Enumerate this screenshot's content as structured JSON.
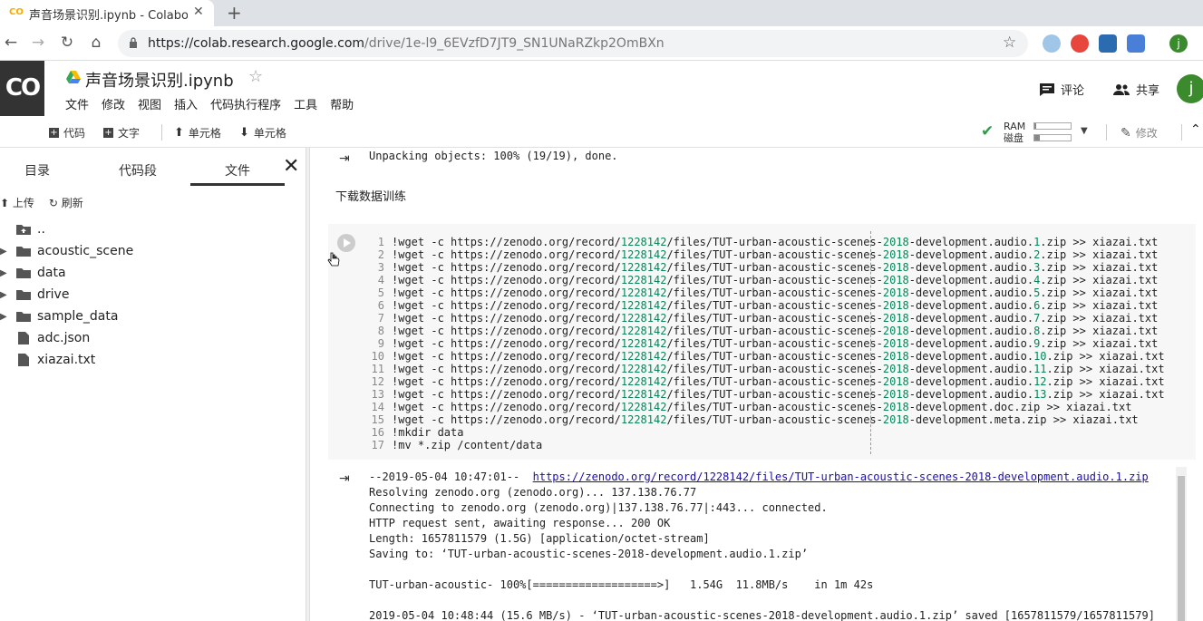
{
  "browser": {
    "tab_title": "声音场景识别.ipynb - Colabor",
    "tab_favicon": "CO",
    "url_host": "https://colab.research.google.com",
    "url_path": "/drive/1e-l9_6EVzfD7JT9_SN1UNaRZkp2OmBXn",
    "profile_initial": "j"
  },
  "header": {
    "logo": "CO",
    "notebook_title": "声音场景识别.ipynb",
    "menu": [
      "文件",
      "修改",
      "视图",
      "插入",
      "代码执行程序",
      "工具",
      "帮助"
    ],
    "comment_label": "评论",
    "share_label": "共享",
    "avatar_initial": "j"
  },
  "toolbar": {
    "add_code": "代码",
    "add_text": "文字",
    "cell_up": "单元格",
    "cell_down": "单元格",
    "ram_label": "RAM",
    "disk_label": "磁盘",
    "edit_label": "修改"
  },
  "sidebar": {
    "tabs": [
      "目录",
      "代码段",
      "文件"
    ],
    "upload_label": "上传",
    "refresh_label": "刷新",
    "files": [
      {
        "name": "..",
        "type": "parent"
      },
      {
        "name": "acoustic_scene",
        "type": "folder"
      },
      {
        "name": "data",
        "type": "folder"
      },
      {
        "name": "drive",
        "type": "folder"
      },
      {
        "name": "sample_data",
        "type": "folder"
      },
      {
        "name": "adc.json",
        "type": "file"
      },
      {
        "name": "xiazai.txt",
        "type": "file"
      }
    ]
  },
  "notebook": {
    "prev_output": "Unpacking objects: 100% (19/19), done.",
    "text_cell": "下载数据训练",
    "code_lines": [
      {
        "n": "1",
        "pre": "!wget -c https://zenodo.org/record/",
        "id": "1228142",
        "mid": "/files/TUT-urban-acoustic-scenes-",
        "yr": "2018",
        "post": "-development.audio.",
        "k": "1",
        "tail": ".zip >> xiazai.txt"
      },
      {
        "n": "2",
        "pre": "!wget -c https://zenodo.org/record/",
        "id": "1228142",
        "mid": "/files/TUT-urban-acoustic-scenes-",
        "yr": "2018",
        "post": "-development.audio.",
        "k": "2",
        "tail": ".zip >> xiazai.txt"
      },
      {
        "n": "3",
        "pre": "!wget -c https://zenodo.org/record/",
        "id": "1228142",
        "mid": "/files/TUT-urban-acoustic-scenes-",
        "yr": "2018",
        "post": "-development.audio.",
        "k": "3",
        "tail": ".zip >> xiazai.txt"
      },
      {
        "n": "4",
        "pre": "!wget -c https://zenodo.org/record/",
        "id": "1228142",
        "mid": "/files/TUT-urban-acoustic-scenes-",
        "yr": "2018",
        "post": "-development.audio.",
        "k": "4",
        "tail": ".zip >> xiazai.txt"
      },
      {
        "n": "5",
        "pre": "!wget -c https://zenodo.org/record/",
        "id": "1228142",
        "mid": "/files/TUT-urban-acoustic-scenes-",
        "yr": "2018",
        "post": "-development.audio.",
        "k": "5",
        "tail": ".zip >> xiazai.txt"
      },
      {
        "n": "6",
        "pre": "!wget -c https://zenodo.org/record/",
        "id": "1228142",
        "mid": "/files/TUT-urban-acoustic-scenes-",
        "yr": "2018",
        "post": "-development.audio.",
        "k": "6",
        "tail": ".zip >> xiazai.txt"
      },
      {
        "n": "7",
        "pre": "!wget -c https://zenodo.org/record/",
        "id": "1228142",
        "mid": "/files/TUT-urban-acoustic-scenes-",
        "yr": "2018",
        "post": "-development.audio.",
        "k": "7",
        "tail": ".zip >> xiazai.txt"
      },
      {
        "n": "8",
        "pre": "!wget -c https://zenodo.org/record/",
        "id": "1228142",
        "mid": "/files/TUT-urban-acoustic-scenes-",
        "yr": "2018",
        "post": "-development.audio.",
        "k": "8",
        "tail": ".zip >> xiazai.txt"
      },
      {
        "n": "9",
        "pre": "!wget -c https://zenodo.org/record/",
        "id": "1228142",
        "mid": "/files/TUT-urban-acoustic-scenes-",
        "yr": "2018",
        "post": "-development.audio.",
        "k": "9",
        "tail": ".zip >> xiazai.txt"
      },
      {
        "n": "10",
        "pre": "!wget -c https://zenodo.org/record/",
        "id": "1228142",
        "mid": "/files/TUT-urban-acoustic-scenes-",
        "yr": "2018",
        "post": "-development.audio.",
        "k": "10",
        "tail": ".zip >> xiazai.txt"
      },
      {
        "n": "11",
        "pre": "!wget -c https://zenodo.org/record/",
        "id": "1228142",
        "mid": "/files/TUT-urban-acoustic-scenes-",
        "yr": "2018",
        "post": "-development.audio.",
        "k": "11",
        "tail": ".zip >> xiazai.txt"
      },
      {
        "n": "12",
        "pre": "!wget -c https://zenodo.org/record/",
        "id": "1228142",
        "mid": "/files/TUT-urban-acoustic-scenes-",
        "yr": "2018",
        "post": "-development.audio.",
        "k": "12",
        "tail": ".zip >> xiazai.txt"
      },
      {
        "n": "13",
        "pre": "!wget -c https://zenodo.org/record/",
        "id": "1228142",
        "mid": "/files/TUT-urban-acoustic-scenes-",
        "yr": "2018",
        "post": "-development.audio.",
        "k": "13",
        "tail": ".zip >> xiazai.txt"
      },
      {
        "n": "14",
        "pre": "!wget -c https://zenodo.org/record/",
        "id": "1228142",
        "mid": "/files/TUT-urban-acoustic-scenes-",
        "yr": "2018",
        "post": "-development.doc.zip >> xiazai.txt",
        "k": "",
        "tail": ""
      },
      {
        "n": "15",
        "pre": "!wget -c https://zenodo.org/record/",
        "id": "1228142",
        "mid": "/files/TUT-urban-acoustic-scenes-",
        "yr": "2018",
        "post": "-development.meta.zip >> xiazai.txt",
        "k": "",
        "tail": ""
      },
      {
        "n": "16",
        "pre": "!mkdir data",
        "id": "",
        "mid": "",
        "yr": "",
        "post": "",
        "k": "",
        "tail": ""
      },
      {
        "n": "17",
        "pre": "!mv *.zip /content/data",
        "id": "",
        "mid": "",
        "yr": "",
        "post": "",
        "k": "",
        "tail": ""
      }
    ],
    "output_lines": [
      {
        "text": "--2019-05-04 10:47:01--  ",
        "link": "https://zenodo.org/record/1228142/files/TUT-urban-acoustic-scenes-2018-development.audio.1.zip"
      },
      {
        "text": "Resolving zenodo.org (zenodo.org)... 137.138.76.77",
        "link": ""
      },
      {
        "text": "Connecting to zenodo.org (zenodo.org)|137.138.76.77|:443... connected.",
        "link": ""
      },
      {
        "text": "HTTP request sent, awaiting response... 200 OK",
        "link": ""
      },
      {
        "text": "Length: 1657811579 (1.5G) [application/octet-stream]",
        "link": ""
      },
      {
        "text": "Saving to: ‘TUT-urban-acoustic-scenes-2018-development.audio.1.zip’",
        "link": ""
      },
      {
        "text": "",
        "link": ""
      },
      {
        "text": "TUT-urban-acoustic- 100%[===================>]   1.54G  11.8MB/s    in 1m 42s",
        "link": ""
      },
      {
        "text": "",
        "link": ""
      },
      {
        "text": "2019-05-04 10:48:44 (15.6 MB/s) - ‘TUT-urban-acoustic-scenes-2018-development.audio.1.zip’ saved [1657811579/1657811579]",
        "link": ""
      }
    ]
  },
  "colors": {
    "number_green": "#098658",
    "link_blue": "#1a0dab",
    "logo_bg": "#333333",
    "avatar_green": "#3b8a2d"
  }
}
